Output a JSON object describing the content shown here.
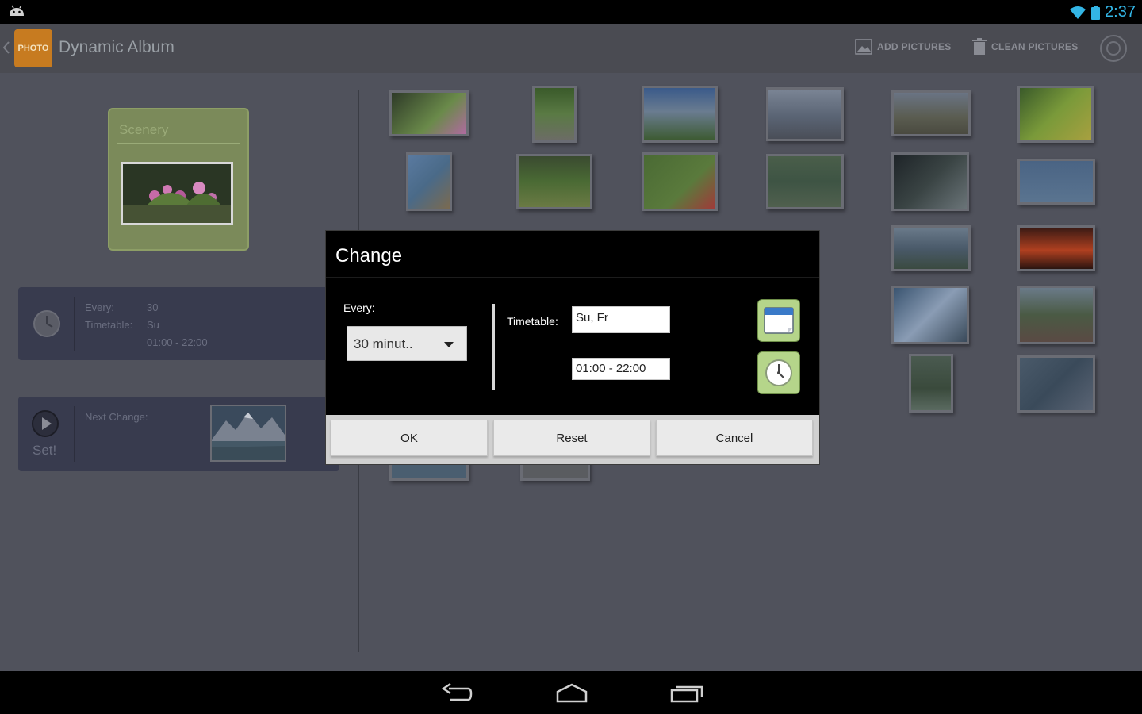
{
  "statusbar": {
    "time": "2:37",
    "accent": "#33b5e5"
  },
  "actionbar": {
    "logo_text": "PHOTO",
    "title": "Dynamic Album",
    "add_pictures": "ADD PICTURES",
    "clean_pictures": "CLEAN PICTURES"
  },
  "album": {
    "name": "Scenery"
  },
  "schedule_panel": {
    "every_label": "Every:",
    "every_value": "30",
    "timetable_label": "Timetable:",
    "timetable_value": "Su",
    "time_range": "01:00 - 22:00"
  },
  "next_panel": {
    "next_change_label": "Next Change:",
    "set_label": "Set!"
  },
  "dialog": {
    "title": "Change",
    "every_label": "Every:",
    "every_value": "30 minut..",
    "timetable_label": "Timetable:",
    "days_value": "Su, Fr",
    "time_value": "01:00 - 22:00",
    "ok": "OK",
    "reset": "Reset",
    "cancel": "Cancel"
  },
  "photos_count": 33
}
